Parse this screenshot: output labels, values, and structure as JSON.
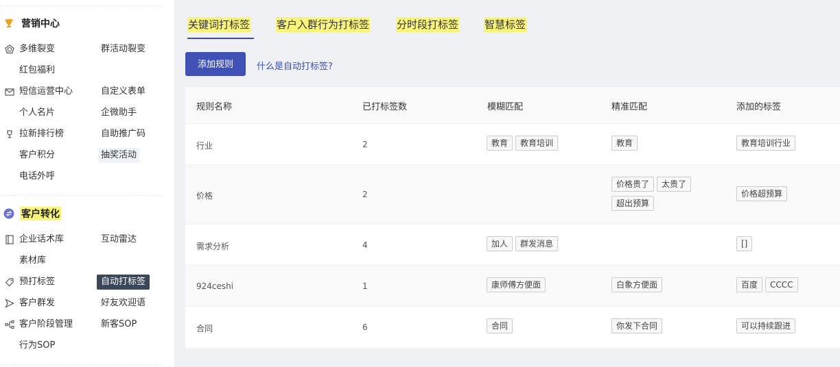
{
  "sidebar": {
    "marketing": {
      "title": "营销中心",
      "items": [
        {
          "label": "多维裂变"
        },
        {
          "label": "群活动裂变"
        },
        {
          "label": "红包福利"
        },
        {
          "label": "短信运营中心"
        },
        {
          "label": "自定义表单"
        },
        {
          "label": "个人名片"
        },
        {
          "label": "企微助手"
        },
        {
          "label": "拉新排行榜"
        },
        {
          "label": "自助推广码"
        },
        {
          "label": "客户积分"
        },
        {
          "label": "抽奖活动"
        },
        {
          "label": "电话外呼"
        }
      ]
    },
    "conversion": {
      "title": "客户转化",
      "items": [
        {
          "label": "企业话术库"
        },
        {
          "label": "互动雷达"
        },
        {
          "label": "素材库"
        },
        {
          "label": "预打标签"
        },
        {
          "label": "自动打标签"
        },
        {
          "label": "客户群发"
        },
        {
          "label": "好友欢迎语"
        },
        {
          "label": "客户阶段管理"
        },
        {
          "label": "新客SOP"
        },
        {
          "label": "行为SOP"
        }
      ]
    }
  },
  "tabs": [
    {
      "label": "关键词打标签"
    },
    {
      "label": "客户入群行为打标签"
    },
    {
      "label": "分时段打标签"
    },
    {
      "label": "智慧标签"
    }
  ],
  "toolbar": {
    "add_label": "添加规则",
    "help_label": "什么是自动打标签?"
  },
  "table": {
    "columns": [
      "规则名称",
      "已打标签数",
      "模糊匹配",
      "精准匹配",
      "添加的标签"
    ],
    "rows": [
      {
        "name": "行业",
        "count": "2",
        "fuzzy": [
          "教育",
          "教育培训"
        ],
        "exact": [
          "教育"
        ],
        "added": [
          "教育培训行业"
        ]
      },
      {
        "name": "价格",
        "count": "2",
        "fuzzy": [],
        "exact": [
          "价格贵了",
          "太贵了",
          "超出预算"
        ],
        "added": [
          "价格超预算"
        ]
      },
      {
        "name": "需求分析",
        "count": "4",
        "fuzzy": [
          "加人",
          "群发消息"
        ],
        "exact": [],
        "added": [
          "[]"
        ]
      },
      {
        "name": "924ceshi",
        "count": "1",
        "fuzzy": [
          "康师傅方便面"
        ],
        "exact": [
          "白象方便面"
        ],
        "added": [
          "百度",
          "CCCC"
        ]
      },
      {
        "name": "合同",
        "count": "6",
        "fuzzy": [
          "合同"
        ],
        "exact": [
          "你发下合同"
        ],
        "added": [
          "可以持续跟进"
        ]
      }
    ]
  },
  "colors": {
    "accent": "#3f51b5",
    "highlight": "#faf57a",
    "active_nav": "#3a4758",
    "trophy": "#f0a020",
    "conversion_icon": "#6c6fd8"
  },
  "icons": {
    "marketing": "trophy-icon",
    "conversion": "exchange-icon"
  }
}
